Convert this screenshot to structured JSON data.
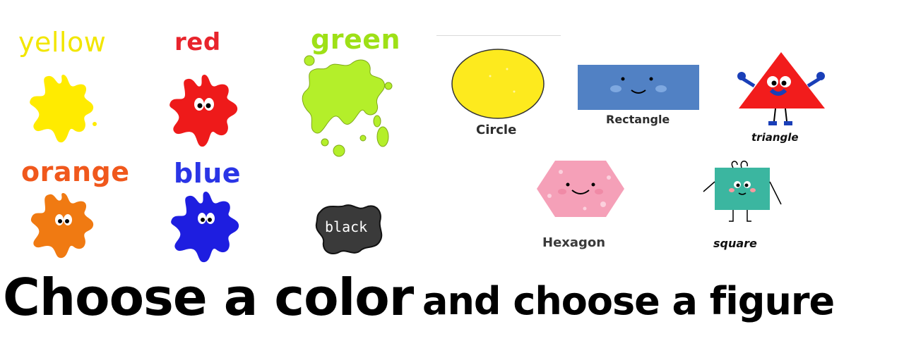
{
  "colors": {
    "yellow": {
      "label": "yellow",
      "text_color": "#f2e600",
      "fill": "#ffeb00"
    },
    "red": {
      "label": "red",
      "text_color": "#e8242c",
      "fill": "#ee1a1a"
    },
    "green": {
      "label": "green",
      "text_color": "#9ee017",
      "fill": "#b4ef2a"
    },
    "orange": {
      "label": "orange",
      "text_color": "#f0581c",
      "fill": "#f07a12"
    },
    "blue": {
      "label": "blue",
      "text_color": "#2a35e6",
      "fill": "#1e1ee0"
    },
    "black": {
      "label": "black",
      "fill": "#3a3a3a"
    }
  },
  "shapes": {
    "circle": {
      "label": "Circle",
      "fill": "#fdea1e"
    },
    "rectangle": {
      "label": "Rectangle",
      "fill": "#5181c4"
    },
    "triangle": {
      "label": "triangle",
      "fill": "#f21c1c"
    },
    "hexagon": {
      "label": "Hexagon",
      "fill": "#f5a0b8"
    },
    "square": {
      "label": "square",
      "fill": "#3bb6a0"
    }
  },
  "heading": {
    "part1": "Choose a color",
    "part2": "and choose a figure"
  }
}
